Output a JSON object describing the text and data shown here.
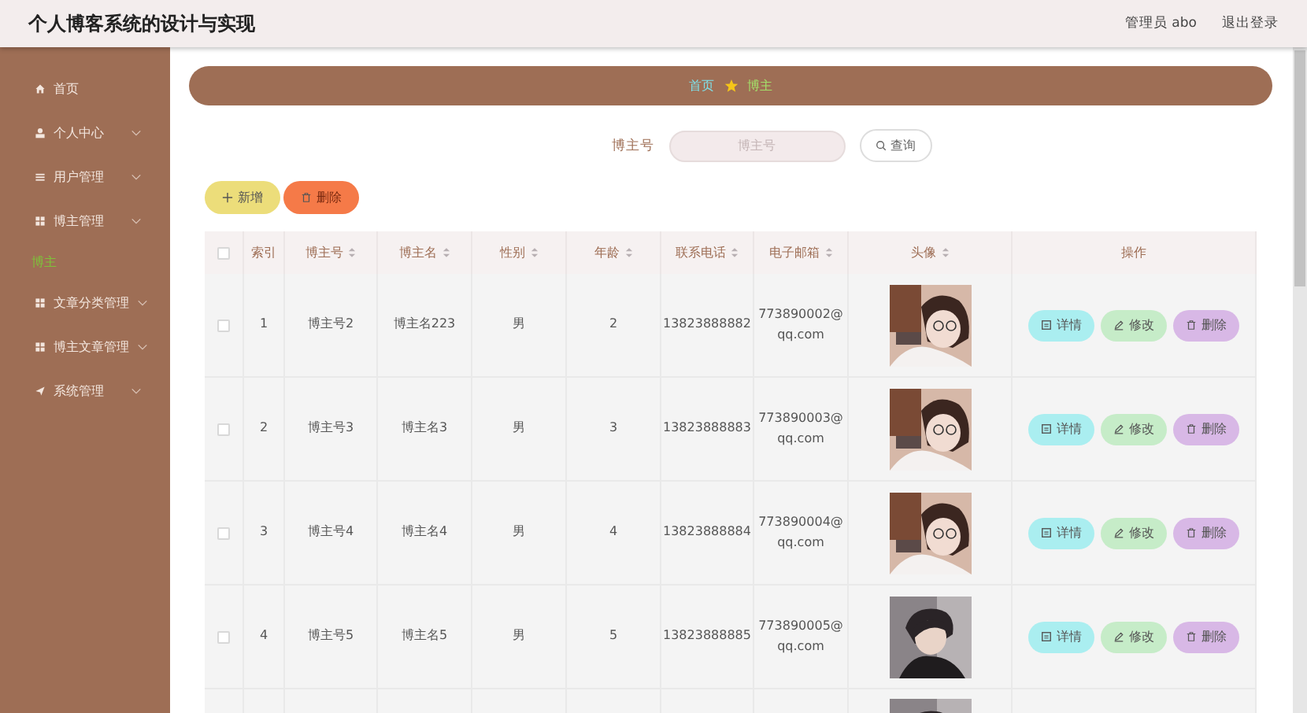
{
  "header": {
    "title": "个人博客系统的设计与实现",
    "user": "管理员 abo",
    "logout": "退出登录"
  },
  "sidebar": {
    "items": [
      {
        "label": "首页",
        "kind": "link",
        "expandable": false,
        "selected": false
      },
      {
        "label": "个人中心",
        "kind": "menu",
        "expandable": true,
        "selected": false
      },
      {
        "label": "用户管理",
        "kind": "menu",
        "expandable": true,
        "selected": false
      },
      {
        "label": "博主管理",
        "kind": "menu",
        "expandable": true,
        "selected": false
      },
      {
        "label": "博主",
        "kind": "sub",
        "selected": true
      },
      {
        "label": "文章分类管理",
        "kind": "menu",
        "expandable": true,
        "selected": false
      },
      {
        "label": "博主文章管理",
        "kind": "menu",
        "expandable": true,
        "selected": false
      },
      {
        "label": "系统管理",
        "kind": "menu",
        "expandable": true,
        "selected": false
      }
    ]
  },
  "breadcrumb": [
    "首页",
    "博主"
  ],
  "search": {
    "label": "博主号",
    "placeholder": "博主号",
    "button": "查询"
  },
  "actions": {
    "add": "新增",
    "delete": "删除"
  },
  "table": {
    "columns": [
      {
        "label": "索引",
        "sortable": false
      },
      {
        "label": "博主号",
        "sortable": true
      },
      {
        "label": "博主名",
        "sortable": true
      },
      {
        "label": "性别",
        "sortable": true
      },
      {
        "label": "年龄",
        "sortable": true
      },
      {
        "label": "联系电话",
        "sortable": true
      },
      {
        "label": "电子邮箱",
        "sortable": true
      },
      {
        "label": "头像",
        "sortable": true
      },
      {
        "label": "操作",
        "sortable": false
      }
    ],
    "header_checked": false,
    "rows": [
      {
        "checked": false,
        "index": "1",
        "blogger_no": "博主号2",
        "blogger_name": "博主名223",
        "gender": "男",
        "age": "2",
        "phone": "13823888882",
        "email": "773890002@qq.com",
        "avatar": {
          "kind": "picture"
        },
        "buttons": [
          "详情",
          "修改",
          "删除"
        ]
      },
      {
        "checked": false,
        "index": "2",
        "blogger_no": "博主号3",
        "blogger_name": "博主名3",
        "gender": "男",
        "age": "3",
        "phone": "13823888883",
        "email": "773890003@qq.com",
        "avatar": {
          "kind": "picture"
        },
        "buttons": [
          "详情",
          "修改",
          "删除"
        ]
      },
      {
        "checked": false,
        "index": "3",
        "blogger_no": "博主号4",
        "blogger_name": "博主名4",
        "gender": "男",
        "age": "4",
        "phone": "13823888884",
        "email": "773890004@qq.com",
        "avatar": {
          "kind": "picture"
        },
        "buttons": [
          "详情",
          "修改",
          "删除"
        ]
      },
      {
        "checked": false,
        "index": "4",
        "blogger_no": "博主号5",
        "blogger_name": "博主名5",
        "gender": "男",
        "age": "5",
        "phone": "13823888885",
        "email": "773890005@qq.com",
        "avatar": {
          "kind": "picture"
        },
        "buttons": [
          "详情",
          "修改",
          "删除"
        ]
      }
    ],
    "partial_row": {
      "avatar": {
        "kind": "picture"
      }
    }
  }
}
